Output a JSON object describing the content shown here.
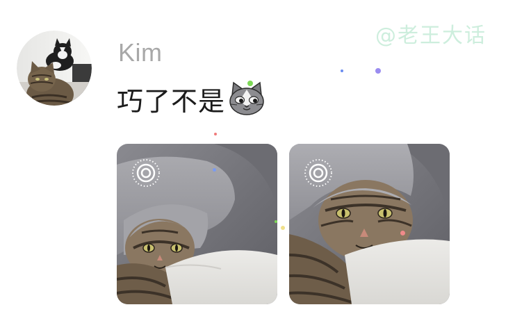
{
  "watermark": "@老王大话",
  "message": {
    "sender": "Kim",
    "text": "巧了不是",
    "emoji": "cat-face-icon"
  },
  "attachments": [
    {
      "type": "live-photo",
      "badge": "live-photo-icon"
    },
    {
      "type": "live-photo",
      "badge": "live-photo-icon"
    }
  ],
  "colors": {
    "background": "#ffffff",
    "username": "#a8a8a8",
    "message_text": "#1b1b1b",
    "watermark": "#cdeedd"
  }
}
